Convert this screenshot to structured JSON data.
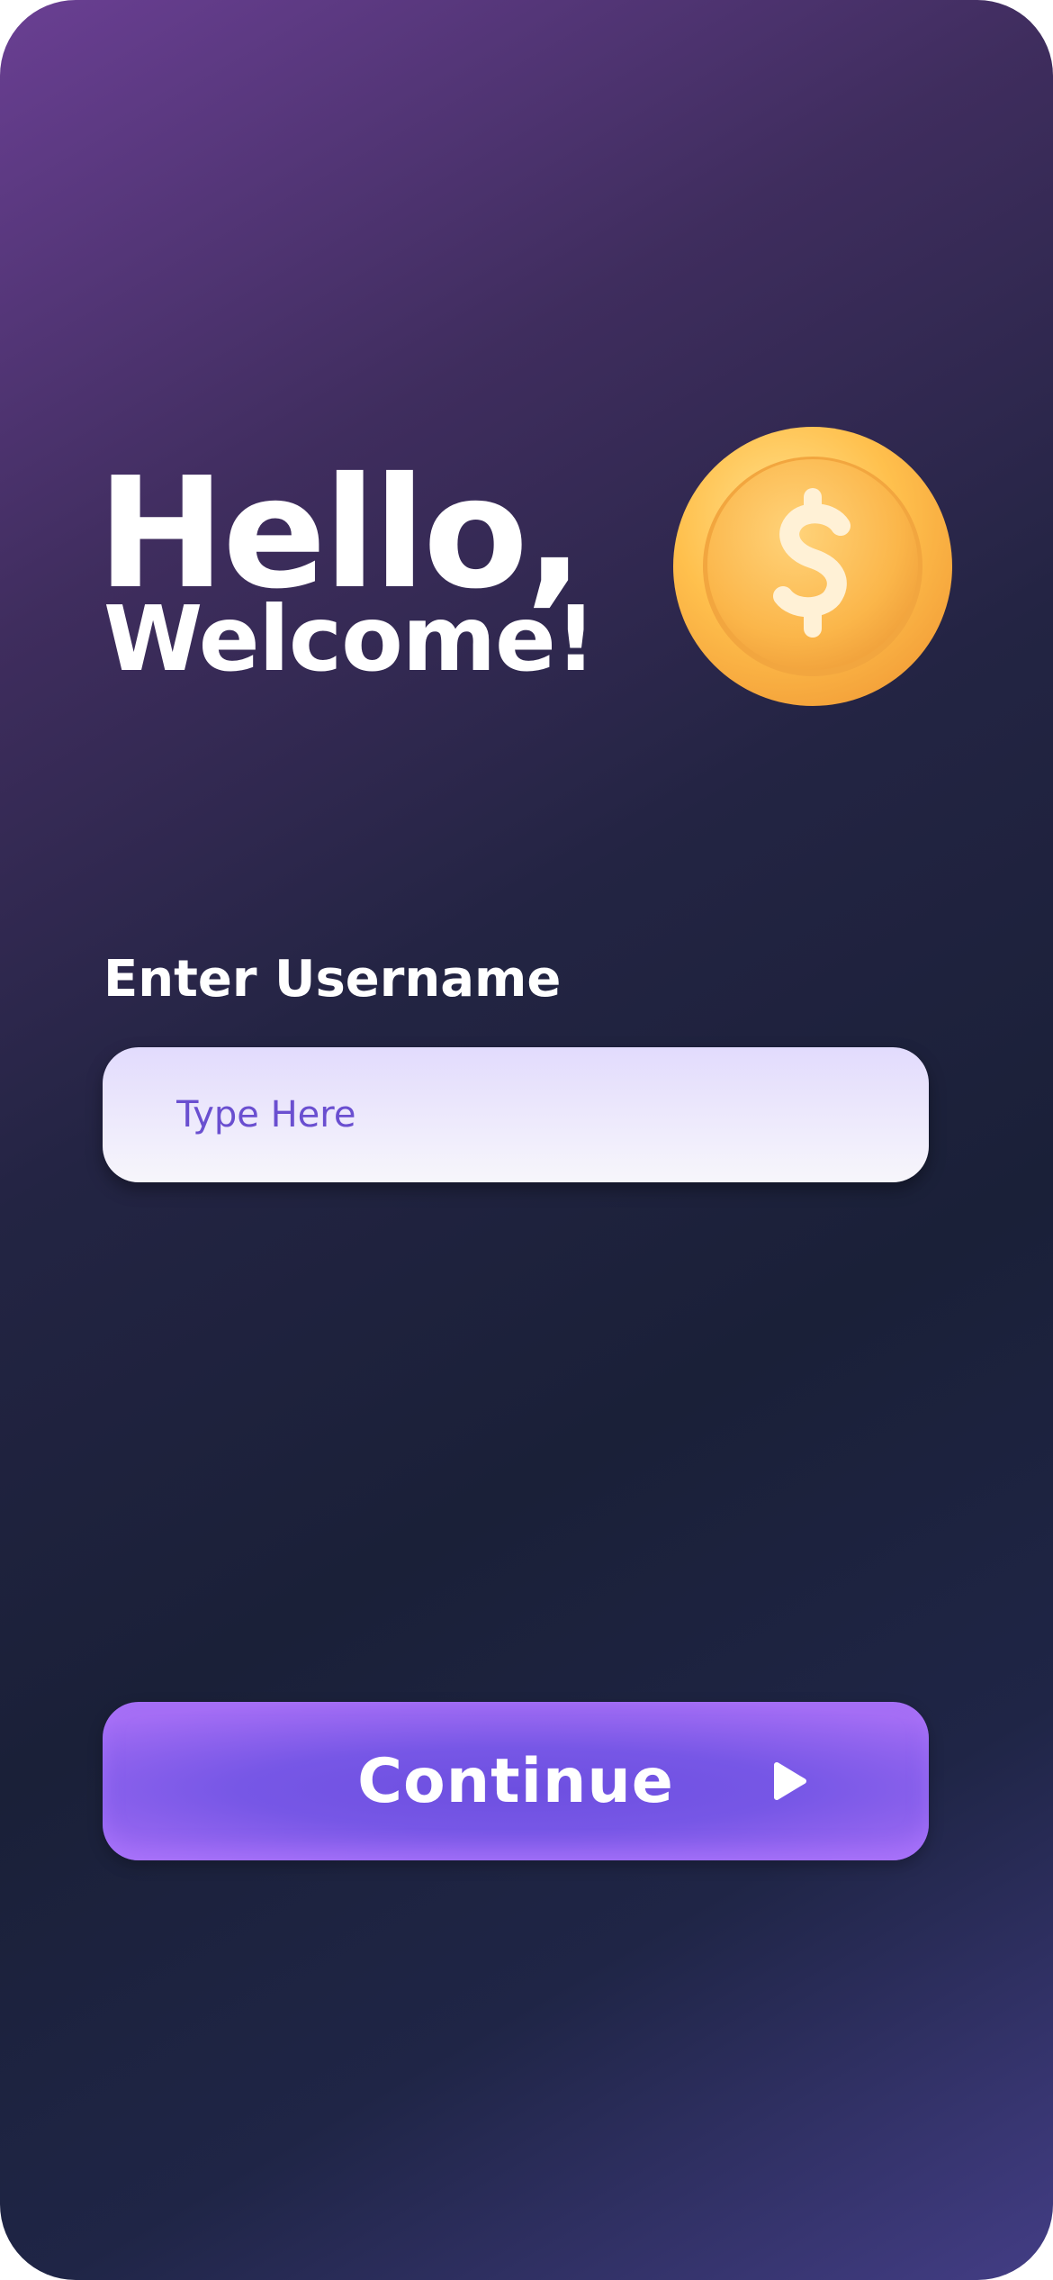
{
  "header": {
    "greeting": "Hello,",
    "welcome": "Welcome!",
    "coin_icon": "dollar-coin-icon"
  },
  "form": {
    "username_label": "Enter Username",
    "username_placeholder": "Type Here",
    "username_value": ""
  },
  "actions": {
    "continue_label": "Continue",
    "continue_icon": "play-icon"
  },
  "colors": {
    "background_top": "#6a3f93",
    "background_middle": "#1a2038",
    "background_bottom": "#433d85",
    "button_accent": "#7757e6",
    "input_text": "#6a4fd0",
    "coin": "#f9b43f"
  }
}
